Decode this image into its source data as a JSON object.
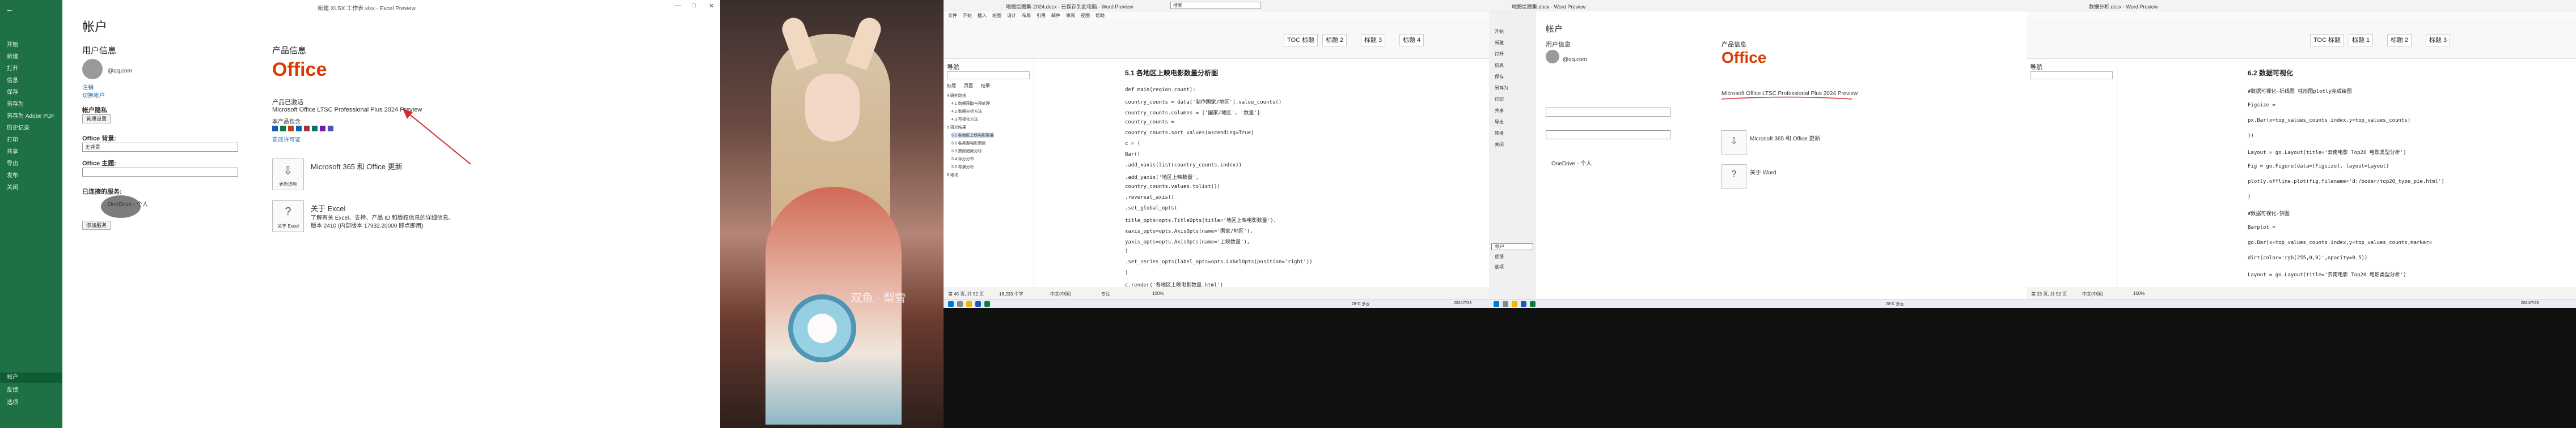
{
  "excel": {
    "title": "新建 XLSX 工作表.xlsx - Excel Preview",
    "sidebar": [
      "开始",
      "新建",
      "打开",
      "信息",
      "保存",
      "另存为",
      "另存为 Adobe PDF",
      "历史记录",
      "打印",
      "共享",
      "导出",
      "发布",
      "关闭"
    ],
    "sidebar_bottom": [
      "帐户",
      "反馈",
      "选项"
    ],
    "selected_sidebar": "帐户",
    "page_title": "帐户",
    "user_info_heading": "用户信息",
    "user_email": "@qq.com",
    "sign_out": "注销",
    "switch_account": "切换帐户",
    "privacy_heading": "帐户隐私",
    "manage_settings": "管理设置",
    "bg_heading": "Office 背景:",
    "bg_value": "无背景",
    "theme_heading": "Office 主题:",
    "theme_value": "",
    "connected_heading": "已连接的服务:",
    "connected_item": "OneDrive - 个人",
    "add_service": "添加服务",
    "product_heading": "产品信息",
    "office_logo": "Office",
    "activated": "产品已激活",
    "product_name": "Microsoft Office LTSC Professional Plus 2024 Preview",
    "contains": "本产品包含",
    "license_link": "更改许可证",
    "m365_title": "Microsoft 365 和 Office 更新",
    "update_options": "更新选项",
    "about_title": "关于 Excel",
    "about_text1": "了解有关 Excel、支持、产品 ID 和版权信息的详细信息。",
    "about_text2": "版本 2410 (内部版本 17932.20000 即点即用)",
    "about_btn": "关于 Excel"
  },
  "photo": {
    "watermark": "双鱼 · 梨雪"
  },
  "word1": {
    "title": "地图绘图集-2024.docx - 已保存到此电脑 - Word Preview",
    "search_placeholder": "搜索",
    "menu": [
      "文件",
      "开始",
      "插入",
      "绘图",
      "设计",
      "布局",
      "引用",
      "邮件",
      "审阅",
      "视图",
      "帮助"
    ],
    "styles": [
      "TOC 标题",
      "标题 2",
      "标题 3",
      "标题 4"
    ],
    "nav_heading": "导航",
    "nav_tabs": [
      "标题",
      "页面",
      "结果"
    ],
    "nav_entries": [
      "4 研究路线",
      "4.1 数据获取与预处理",
      "4.2 数据分析方法",
      "4.3 可视化方法",
      "5 研究结果",
      "5.1 各地区上映电影数量",
      "5.2 各类型电影票房",
      "5.3 票房趋势分析",
      "5.4 评分分布",
      "5.5 导演分析",
      "6 结论"
    ],
    "section_title": "5.1 各地区上映电影数量分析图",
    "code": [
      "def main(region_count):",
      "    country_counts = data['制作国家/地区'].value_counts()",
      "    country_counts.columns = ['国家/地区', '数量']",
      "    country_counts =",
      "    country_counts.sort_values(ascending=True)",
      "    c = (",
      "        Bar()",
      "        .add_xaxis(list(country_counts.index))",
      "        .add_yaxis('地区上映数量',",
      "    country_counts.values.tolist())",
      "        .reversal_axis()",
      "        .set_global_opts(",
      "    title_opts=opts.TitleOpts(title='地区上映电影数量'),",
      "    xaxis_opts=opts.AxisOpts(name='国家/地区'),",
      "    yaxis_opts=opts.AxisOpts(name='上映数量'),",
      "        )",
      "        .set_series_opts(label_opts=opts.LabelOpts(position='right'))",
      "    )",
      "    c.render('各地区上映电影数量.html')"
    ],
    "status": [
      "第 45 页, 共 52 页",
      "18,233 个字",
      "中文(中国)",
      "专注",
      "100%"
    ]
  },
  "acct": {
    "title": "地图绘图集.docx - Word Preview",
    "sidebar": [
      "开始",
      "新建",
      "打开",
      "信息",
      "保存",
      "另存为",
      "打印",
      "共享",
      "导出",
      "转换",
      "关闭"
    ],
    "sidebar_bottom": [
      "帐户",
      "反馈",
      "选项"
    ],
    "page_title": "帐户",
    "user_info_heading": "用户信息",
    "user_email": "@qq.com",
    "product_heading": "产品信息",
    "office_logo": "Office",
    "product_name": "Microsoft Office LTSC Professional Plus 2024 Preview",
    "m365_title": "Microsoft 365 和 Office 更新",
    "about_title": "关于 Word",
    "connected_item": "OneDrive - 个人"
  },
  "word2": {
    "title": "数据分析.docx - Word Preview",
    "styles": [
      "TOC 标题",
      "标题 1",
      "标题 2",
      "标题 3"
    ],
    "nav_heading": "导航",
    "section_title": "6.2 数据可视化",
    "code": [
      "#数据可视化-折线图    柱形图plotly完成绘图",
      "Figsize =",
      "px.Bar(x=top_values_counts.index,y=top_values_counts)",
      "))",
      "Layout = go.Layout(title='云南电影 Top20 电影类型分析')",
      "Fig = go.Figure(data=[Figsize], layout=Layout)",
      "plotly.offline.plot(fig,filename='d:/boder/top20_type_pie.html')",
      ")",
      "#数据可视化-饼图",
      "Barplot =",
      "go.Bar(x=top_values_counts.index,y=top_values_counts,marker=",
      "dict(color='rgb(255,0,0)',opacity=0.5))",
      "Layout = go.Layout(title='云南电影 Top20 电影类型分析')"
    ],
    "status": [
      "第 23 页, 共 52 页",
      "中文(中国)",
      "100%"
    ]
  },
  "taskbar": {
    "weather1": "28°C 多云",
    "time1": "2024/7/23",
    "weather2": "28°C 多云",
    "time2": "2024/7/23"
  }
}
